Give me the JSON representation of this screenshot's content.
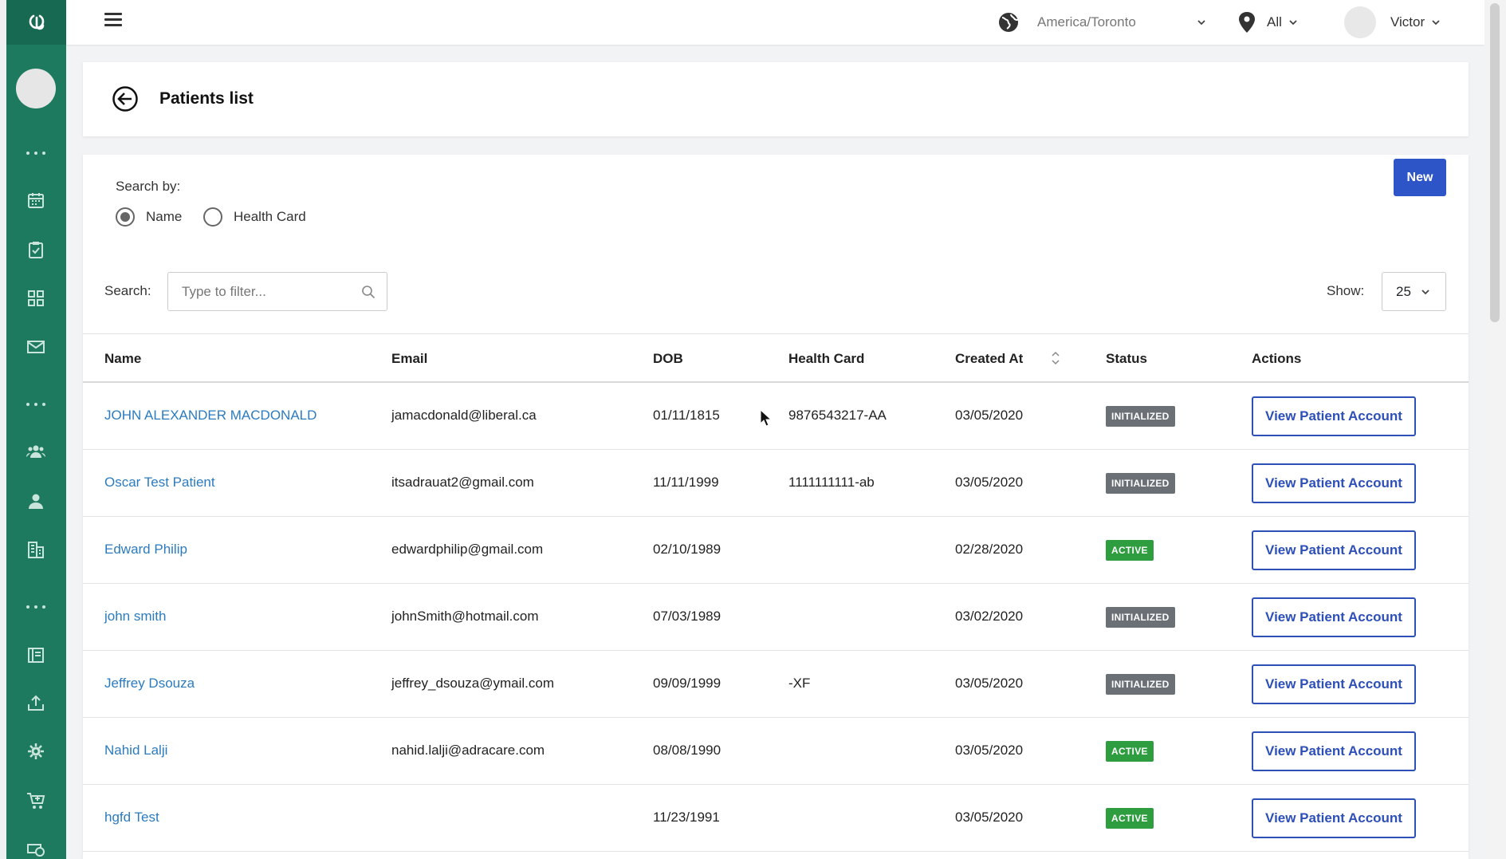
{
  "topbar": {
    "timezone": "America/Toronto",
    "location": "All",
    "user_name": "Victor"
  },
  "page": {
    "title": "Patients list"
  },
  "search_by": {
    "label": "Search by:",
    "options": [
      "Name",
      "Health Card"
    ],
    "selected": "Name"
  },
  "new_button": "New",
  "search": {
    "label": "Search:",
    "placeholder": "Type to filter..."
  },
  "show": {
    "label": "Show:",
    "value": "25"
  },
  "table": {
    "columns": [
      "Name",
      "Email",
      "DOB",
      "Health Card",
      "Created At",
      "Status",
      "Actions"
    ],
    "action_label": "View Patient Account",
    "rows": [
      {
        "name": "JOHN ALEXANDER MACDONALD",
        "email": "jamacdonald@liberal.ca",
        "dob": "01/11/1815",
        "health_card": "9876543217-AA",
        "created_at": "03/05/2020",
        "status": "INITIALIZED"
      },
      {
        "name": "Oscar Test Patient",
        "email": "itsadrauat2@gmail.com",
        "dob": "11/11/1999",
        "health_card": "1111111111-ab",
        "created_at": "03/05/2020",
        "status": "INITIALIZED"
      },
      {
        "name": "Edward Philip",
        "email": "edwardphilip@gmail.com",
        "dob": "02/10/1989",
        "health_card": "",
        "created_at": "02/28/2020",
        "status": "ACTIVE"
      },
      {
        "name": "john smith",
        "email": "johnSmith@hotmail.com",
        "dob": "07/03/1989",
        "health_card": "",
        "created_at": "03/02/2020",
        "status": "INITIALIZED"
      },
      {
        "name": "Jeffrey Dsouza",
        "email": "jeffrey_dsouza@ymail.com",
        "dob": "09/09/1999",
        "health_card": "-XF",
        "created_at": "03/05/2020",
        "status": "INITIALIZED"
      },
      {
        "name": "Nahid Lalji",
        "email": "nahid.lalji@adracare.com",
        "dob": "08/08/1990",
        "health_card": "",
        "created_at": "03/05/2020",
        "status": "ACTIVE"
      },
      {
        "name": "hgfd Test",
        "email": "",
        "dob": "11/23/1991",
        "health_card": "",
        "created_at": "03/05/2020",
        "status": "ACTIVE"
      }
    ]
  },
  "colors": {
    "sidebar": "#1e7a5e",
    "primary_button": "#2d55c8",
    "link": "#2b7bbf",
    "status_initialized": "#6b6f76",
    "status_active": "#2e9d3f"
  },
  "icons": {
    "sidebar": [
      "logo-icon",
      "dots-icon",
      "calendar-icon",
      "clipboard-check-icon",
      "grid-icon",
      "mail-icon",
      "dots-icon",
      "users-icon",
      "user-icon",
      "building-icon",
      "dots-icon",
      "book-icon",
      "upload-icon",
      "gear-icon",
      "cart-icon",
      "money-icon"
    ]
  }
}
